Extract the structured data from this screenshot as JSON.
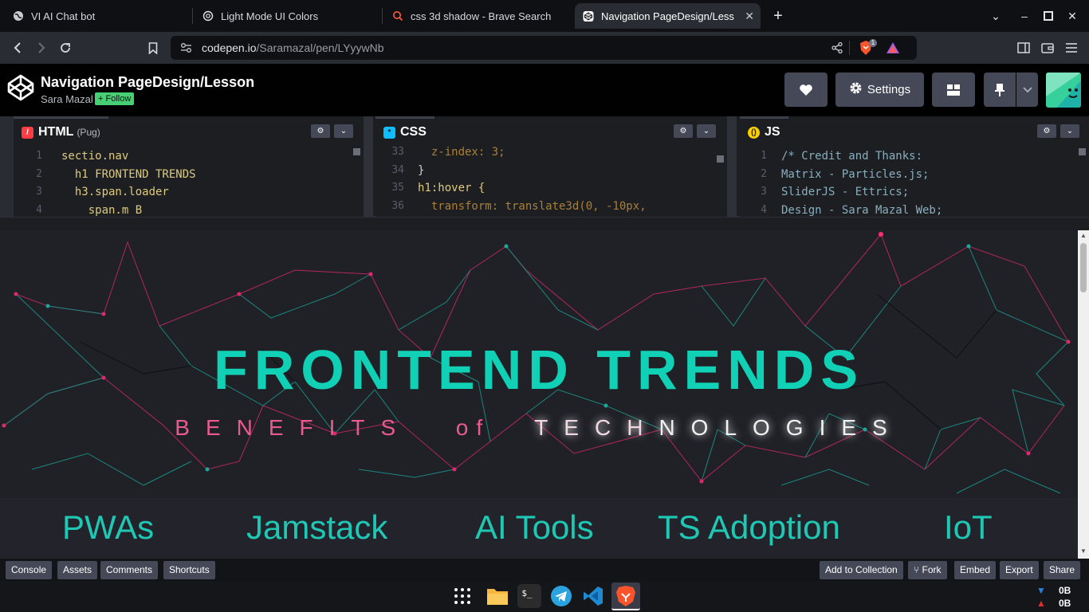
{
  "browser": {
    "tabs": [
      {
        "title": "VI AI Chat bot",
        "icon": "globe-icon"
      },
      {
        "title": "Light Mode UI Colors",
        "icon": "openai-icon"
      },
      {
        "title": "css 3d shadow - Brave Search",
        "icon": "brave-search-icon"
      },
      {
        "title": "Navigation PageDesign/Less",
        "icon": "codepen-icon",
        "active": true
      }
    ],
    "url_host": "codepen.io",
    "url_path": "/Saramazal/pen/LYyywNb",
    "brave_badge": "1"
  },
  "codepen": {
    "pen_title": "Navigation PageDesign/Lesson",
    "author": "Sara Mazal",
    "follow_label": "+ Follow",
    "settings_label": "Settings"
  },
  "editors": {
    "html": {
      "label": "HTML",
      "sublabel": "(Pug)",
      "lines": [
        {
          "n": "1",
          "code": "sectio.nav"
        },
        {
          "n": "2",
          "code": "  h1 FRONTEND TRENDS"
        },
        {
          "n": "3",
          "code": "  h3.span.loader"
        },
        {
          "n": "4",
          "code": "    span.m B"
        }
      ]
    },
    "css": {
      "label": "CSS",
      "lines": [
        {
          "n": "33",
          "code": "  z-index: 3;"
        },
        {
          "n": "34",
          "code": "}"
        },
        {
          "n": "35",
          "code": "h1:hover {"
        },
        {
          "n": "36",
          "code": "  transform: translate3d(0, -10px,"
        }
      ]
    },
    "js": {
      "label": "JS",
      "lines": [
        {
          "n": "1",
          "code": "/* Credit and Thanks:"
        },
        {
          "n": "2",
          "code": "Matrix - Particles.js;"
        },
        {
          "n": "3",
          "code": "SliderJS - Ettrics;"
        },
        {
          "n": "4",
          "code": "Design - Sara Mazal Web;"
        }
      ]
    }
  },
  "preview": {
    "title": "FRONTEND TRENDS",
    "subtitle_words": [
      {
        "text": "BENEFITS",
        "style": "pink"
      },
      {
        "text": "of",
        "style": "pink"
      },
      {
        "text": "TECH",
        "style": "pink"
      },
      {
        "text": "NOLOGIES",
        "style": "white"
      }
    ],
    "nav_links": [
      "PWAs",
      "Jamstack",
      "AI Tools",
      "TS Adoption",
      "IoT"
    ],
    "accent_color": "#10d0b6",
    "pink_color": "#e95b8e"
  },
  "footer": {
    "left_buttons": [
      "Console",
      "Assets",
      "Comments",
      "Shortcuts"
    ],
    "right_buttons": [
      "Add to Collection",
      "Fork",
      "Embed",
      "Export",
      "Share"
    ]
  },
  "taskbar": {
    "apps": [
      "apps-grid-icon",
      "files-icon",
      "terminal-icon",
      "telegram-icon",
      "vscode-icon",
      "brave-icon"
    ],
    "net_down": "0B",
    "net_up": "0B"
  }
}
